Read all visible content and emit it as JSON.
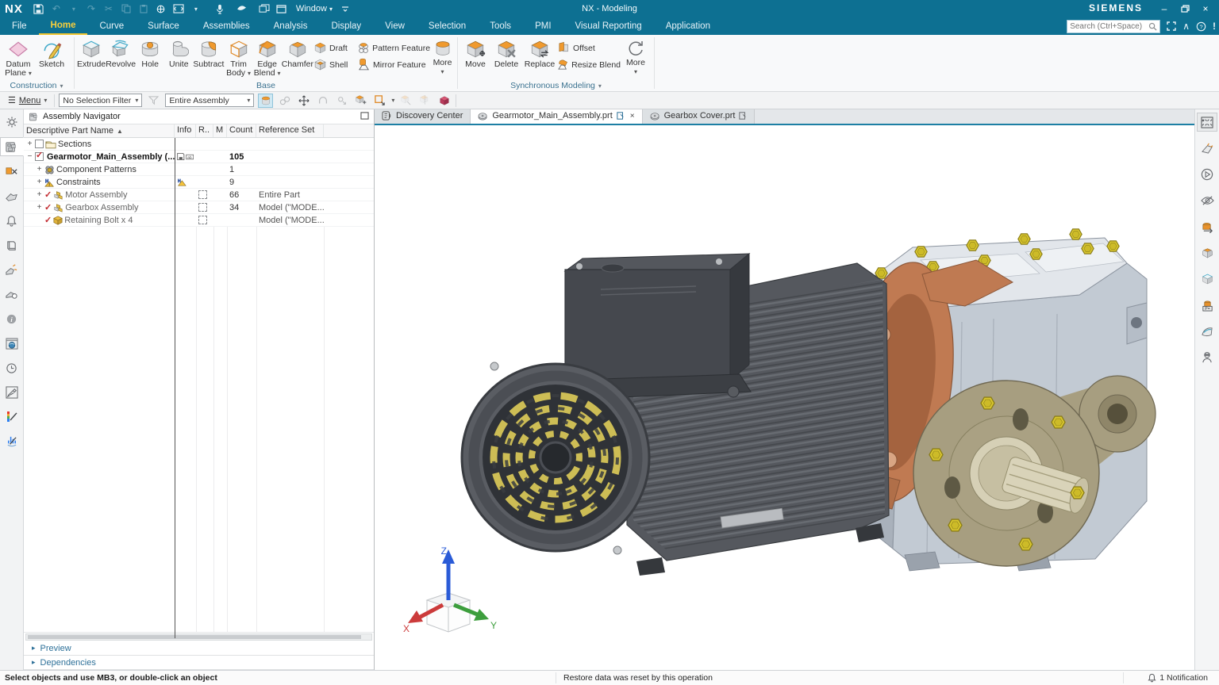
{
  "titlebar": {
    "logo": "NX",
    "window_menu": "Window",
    "title": "NX - Modeling",
    "brand": "SIEMENS"
  },
  "glyphs": {
    "menu": "☰",
    "caret": "▾",
    "caret_right": "▸",
    "plus": "+",
    "minus": "−",
    "close": "×",
    "minimize": "–",
    "undo": "↶",
    "redo": "↷",
    "cut": "✂",
    "collapse": "∧",
    "help": "?",
    "alert": "!",
    "col_sort": "▲"
  },
  "menubar": {
    "items": [
      "File",
      "Home",
      "Curve",
      "Surface",
      "Assemblies",
      "Analysis",
      "Display",
      "View",
      "Selection",
      "Tools",
      "PMI",
      "Visual Reporting",
      "Application"
    ],
    "active": "Home",
    "search_placeholder": "Search (Ctrl+Space)"
  },
  "ribbon": {
    "construction": {
      "label": "Construction",
      "datum_plane": "Datum Plane",
      "sketch": "Sketch"
    },
    "base": {
      "label": "Base",
      "extrude": "Extrude",
      "revolve": "Revolve",
      "hole": "Hole",
      "unite": "Unite",
      "subtract": "Subtract",
      "trim_body": "Trim Body",
      "edge_blend": "Edge Blend",
      "chamfer": "Chamfer",
      "draft": "Draft",
      "shell": "Shell",
      "pattern_feature": "Pattern Feature",
      "mirror_feature": "Mirror Feature",
      "more": "More"
    },
    "sync": {
      "label": "Synchronous Modeling",
      "move": "Move",
      "delete": "Delete",
      "replace": "Replace",
      "offset": "Offset",
      "resize_blend": "Resize Blend",
      "more": "More"
    }
  },
  "utilbar": {
    "menu": "Menu",
    "selection_filter": "No Selection Filter",
    "scope": "Entire Assembly"
  },
  "navigator": {
    "title": "Assembly Navigator",
    "columns": {
      "name": "Descriptive Part Name",
      "info": "Info",
      "r": "R..",
      "m": "M",
      "count": "Count",
      "ref": "Reference Set"
    },
    "rows": [
      {
        "name": "Sections"
      },
      {
        "name": "Gearmotor_Main_Assembly (...",
        "count": "105"
      },
      {
        "name": "Component Patterns",
        "count": "1"
      },
      {
        "name": "Constraints",
        "count": "9"
      },
      {
        "name": "Motor Assembly",
        "count": "66",
        "ref": "Entire Part"
      },
      {
        "name": "Gearbox Assembly",
        "count": "34",
        "ref": "Model (\"MODE..."
      },
      {
        "name": "Retaining Bolt x 4",
        "ref": "Model (\"MODE..."
      }
    ],
    "sections": {
      "preview": "Preview",
      "dependencies": "Dependencies"
    }
  },
  "tabs": [
    {
      "label": "Discovery Center"
    },
    {
      "label": "Gearmotor_Main_Assembly.prt"
    },
    {
      "label": "Gearbox Cover.prt"
    }
  ],
  "viewport": {
    "triad": {
      "x": "X",
      "y": "Y",
      "z": "Z"
    }
  },
  "statusbar": {
    "left": "Select objects and use MB3, or double-click an object",
    "center": "Restore data was reset by this operation",
    "notification": "1 Notification"
  },
  "colors": {
    "titlebar_teal": "#0d7092",
    "active_tab_yellow": "#f0c52e",
    "ribbon_icon_orange": "#f09a2e",
    "check_red": "#c1272d",
    "bolt_yellow": "#d9c72e",
    "copper": "#c07a52",
    "motor_gray": "#55585e",
    "gearbox_gray": "#c2cad3",
    "flange_tan": "#a79e80"
  }
}
